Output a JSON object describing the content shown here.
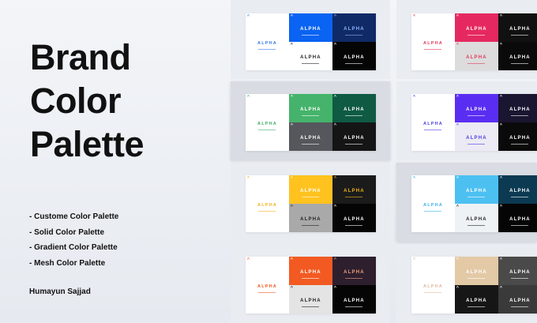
{
  "title_lines": [
    "Brand",
    "Color",
    "Palette"
  ],
  "features": [
    "- Custome Color Palette",
    "- Solid Color Palette",
    "- Gradient Color Palette",
    "- Mesh Color Palette"
  ],
  "author": "Humayun Sajjad",
  "logo_text": "ALPHA",
  "mark_glyph": "^",
  "cards": [
    {
      "cells": [
        {
          "bg": "#ffffff",
          "fg": "#3a7be8",
          "mark": "#3a7be8"
        },
        {
          "bg": "#0a63f2",
          "fg": "#ffffff",
          "mark": "#ffffff"
        },
        {
          "bg": "#0f2a66",
          "fg": "#8fb3ff",
          "mark": "#8fb3ff"
        },
        {
          "bg": "#ffffff",
          "fg": "#222222",
          "mark": "#222222"
        },
        {
          "bg": "#050505",
          "fg": "#ffffff",
          "mark": "#ffffff"
        }
      ]
    },
    {
      "cells": [
        {
          "bg": "#ffffff",
          "fg": "#e13a5a",
          "mark": "#e13a5a"
        },
        {
          "bg": "#e52960",
          "fg": "#ffffff",
          "mark": "#ffffff"
        },
        {
          "bg": "#111111",
          "fg": "#ffffff",
          "mark": "#ffffff"
        },
        {
          "bg": "#dcdcdc",
          "fg": "#e13a5a",
          "mark": "#e13a5a"
        },
        {
          "bg": "#0a0a0a",
          "fg": "#ffffff",
          "mark": "#ffffff"
        }
      ]
    },
    {
      "cells": [
        {
          "bg": "#ffffff",
          "fg": "#3fae6a",
          "mark": "#3fae6a"
        },
        {
          "bg": "#45b36b",
          "fg": "#ffffff",
          "mark": "#ffffff"
        },
        {
          "bg": "#0f5a43",
          "fg": "#ffffff",
          "mark": "#ffffff"
        },
        {
          "bg": "#55575c",
          "fg": "#ffffff",
          "mark": "#ffffff"
        },
        {
          "bg": "#151515",
          "fg": "#ffffff",
          "mark": "#ffffff"
        }
      ]
    },
    {
      "cells": [
        {
          "bg": "#ffffff",
          "fg": "#4b3ee0",
          "mark": "#4b3ee0"
        },
        {
          "bg": "#5a2ef2",
          "fg": "#ffffff",
          "mark": "#ffffff"
        },
        {
          "bg": "#1a1530",
          "fg": "#ffffff",
          "mark": "#ffffff"
        },
        {
          "bg": "#eceaf4",
          "fg": "#4b3ee0",
          "mark": "#4b3ee0"
        },
        {
          "bg": "#0a0a0a",
          "fg": "#ffffff",
          "mark": "#ffffff"
        }
      ]
    },
    {
      "cells": [
        {
          "bg": "#ffffff",
          "fg": "#f2b21a",
          "mark": "#f2b21a"
        },
        {
          "bg": "#ffc21f",
          "fg": "#ffffff",
          "mark": "#ffffff"
        },
        {
          "bg": "#1b1b1b",
          "fg": "#f2b21a",
          "mark": "#f2b21a"
        },
        {
          "bg": "#a9a9a9",
          "fg": "#222222",
          "mark": "#222222"
        },
        {
          "bg": "#050505",
          "fg": "#ffffff",
          "mark": "#ffffff"
        }
      ]
    },
    {
      "cells": [
        {
          "bg": "#ffffff",
          "fg": "#3cb2ea",
          "mark": "#3cb2ea"
        },
        {
          "bg": "#4dc0f2",
          "fg": "#ffffff",
          "mark": "#ffffff"
        },
        {
          "bg": "#0b3a52",
          "fg": "#ffffff",
          "mark": "#ffffff"
        },
        {
          "bg": "#eef2f5",
          "fg": "#222222",
          "mark": "#222222"
        },
        {
          "bg": "#050505",
          "fg": "#ffffff",
          "mark": "#ffffff"
        }
      ]
    },
    {
      "cells": [
        {
          "bg": "#ffffff",
          "fg": "#f25a22",
          "mark": "#f25a22"
        },
        {
          "bg": "#f25a22",
          "fg": "#ffffff",
          "mark": "#ffffff"
        },
        {
          "bg": "#2d1f2e",
          "fg": "#f2a07a",
          "mark": "#f2a07a"
        },
        {
          "bg": "#e4e4e4",
          "fg": "#222222",
          "mark": "#222222"
        },
        {
          "bg": "#050505",
          "fg": "#ffffff",
          "mark": "#ffffff"
        }
      ]
    },
    {
      "cells": [
        {
          "bg": "#ffffff",
          "fg": "#e0b9a0",
          "mark": "#e0b9a0"
        },
        {
          "bg": "#e3c9a6",
          "fg": "#ffffff",
          "mark": "#ffffff"
        },
        {
          "bg": "#4a4a4a",
          "fg": "#ffffff",
          "mark": "#ffffff"
        },
        {
          "bg": "#161616",
          "fg": "#ffffff",
          "mark": "#ffffff"
        },
        {
          "bg": "#3a3a3a",
          "fg": "#ffffff",
          "mark": "#ffffff"
        }
      ]
    }
  ]
}
